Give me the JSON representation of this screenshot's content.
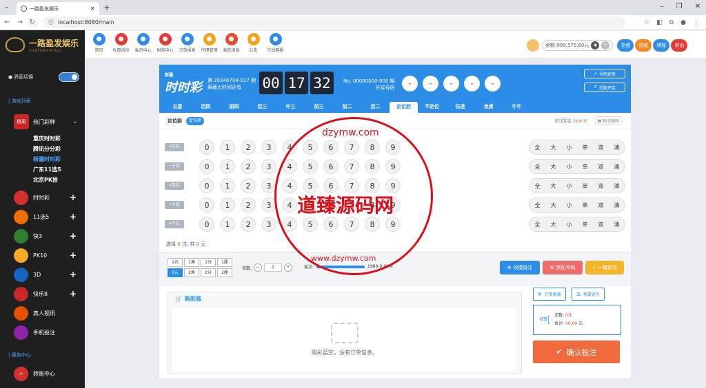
{
  "browser": {
    "tab_title": "一路盈发娱乐",
    "url": "localhost:8080/main",
    "new_tab": "+",
    "tab_close": "×"
  },
  "brand": {
    "name": "一路盈发娱乐",
    "sub": "YILUYINGFATULE"
  },
  "nav": [
    {
      "label": "首页",
      "color": "#2e8de8"
    },
    {
      "label": "优惠活动",
      "color": "#e53935"
    },
    {
      "label": "会员中心",
      "color": "#2e8de8"
    },
    {
      "label": "财务中心",
      "color": "#e53935"
    },
    {
      "label": "订单报表",
      "color": "#2e8de8"
    },
    {
      "label": "代理管理",
      "color": "#f4a21e"
    },
    {
      "label": "我的消息",
      "color": "#e54d2e"
    },
    {
      "label": "公告",
      "color": "#f4a21e"
    },
    {
      "label": "在线客服",
      "color": "#2e8de8"
    }
  ],
  "account": {
    "balance": "余额:999,575.80元",
    "buttons": [
      {
        "label": "充值",
        "color": "#2e8de8"
      },
      {
        "label": "提款",
        "color": "#f4891e"
      },
      {
        "label": "转账",
        "color": "#2e8de8"
      },
      {
        "label": "退出",
        "color": "#e53935"
      }
    ]
  },
  "sidebar": {
    "theme_label": "界面切换",
    "section_games": "游戏列表",
    "hot": {
      "label": "热门彩种",
      "sign": "-",
      "icon_text": "热彩"
    },
    "hot_items": [
      {
        "label": "重庆时时彩",
        "active": false
      },
      {
        "label": "腾讯分分彩",
        "active": false
      },
      {
        "label": "新疆时时彩",
        "active": true
      },
      {
        "label": "广东11选5",
        "active": false
      },
      {
        "label": "北京PK拾",
        "active": false
      }
    ],
    "lotteries": [
      {
        "label": "时时彩",
        "sign": "+",
        "color": "#d32f2f"
      },
      {
        "label": "11选5",
        "sign": "+",
        "color": "#ef6c00"
      },
      {
        "label": "快3",
        "sign": "+",
        "color": "#2e7d32"
      },
      {
        "label": "PK10",
        "sign": "+",
        "color": "#f9a825"
      },
      {
        "label": "3D",
        "sign": "+",
        "color": "#1565c0"
      },
      {
        "label": "快乐8",
        "sign": "+",
        "color": "#c62828"
      },
      {
        "label": "真人视讯",
        "sign": "",
        "color": "#e65100"
      },
      {
        "label": "手机投注",
        "sign": "",
        "color": "#8e24aa"
      }
    ],
    "section_service": "服务中心",
    "service_items": [
      {
        "label": "转账中心"
      }
    ]
  },
  "game": {
    "logo": "时时彩",
    "logo_sub": "新疆",
    "issue": "第 20240708-017 期",
    "issue_sub": "离截止时间还有",
    "timer": [
      "00",
      "17",
      "32"
    ],
    "prev_no": "No. 00000000-000 期",
    "prev_sub": "开奖号码",
    "balls": [
      "-",
      "-",
      "-",
      "-",
      "-"
    ],
    "btn_trend": "号码走势",
    "btn_recent": "近期开奖",
    "play_tabs": [
      "五星",
      "后四",
      "前四",
      "后三",
      "中三",
      "前三",
      "前二",
      "后二",
      "定位胆",
      "不定位",
      "任选",
      "龙虎",
      "牛牛"
    ],
    "active_tab": 8,
    "sub_title": "定位胆",
    "sub_pill": "定位胆",
    "bonus_label": "单注奖金:",
    "bonus_value": "19.8",
    "bonus_unit": "元",
    "rules": "玩法规则",
    "positions": [
      "万位",
      "千位",
      "百位",
      "十位",
      "个位"
    ],
    "digits": [
      "0",
      "1",
      "2",
      "3",
      "4",
      "5",
      "6",
      "7",
      "8",
      "9"
    ],
    "quick": [
      "全",
      "大",
      "小",
      "单",
      "双",
      "清"
    ],
    "sum": {
      "pre": "选择",
      "count": "0",
      "mid": "注, 共",
      "amount": "0",
      "unit": "元"
    },
    "units": [
      "1元",
      "1角",
      "1分",
      "1厘",
      "2元",
      "2角",
      "2分",
      "2厘"
    ],
    "selected_unit": 4,
    "mult_label": "倍数:",
    "mult_value": "1",
    "mult_minus": "−",
    "mult_plus": "+",
    "rebate_label": "返点:",
    "rebate_value": "1980-0.00%",
    "btn_quick": "快捷投注",
    "btn_add": "添加号码",
    "btn_one": "一键投注"
  },
  "cart": {
    "title": "购彩篮",
    "empty": "购彩蓝空，没有订单信息。",
    "btn_report": "订单报表",
    "btn_track": "我要追号",
    "side_label": "结算",
    "bets_label": "注数:",
    "bets_value": "0注",
    "total_label": "合计:",
    "total_value": "¥0.00",
    "total_unit": "元",
    "confirm": "确认投注"
  },
  "watermark": {
    "text": "道臻源码网",
    "top": "dzymw.com",
    "bottom": "www.dzymw.com"
  }
}
